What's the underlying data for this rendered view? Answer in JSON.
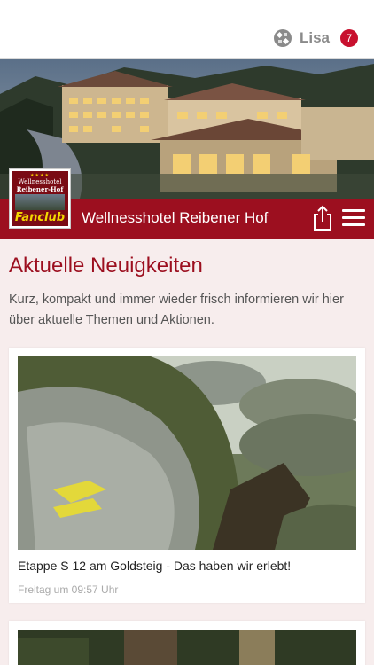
{
  "header": {
    "user_name": "Lisa",
    "notification_count": "7",
    "user_icon": "grid-logo-icon"
  },
  "titlebar": {
    "title": "Wellnesshotel Reibener Hof",
    "share_icon": "share-icon",
    "menu_icon": "hamburger-menu-icon"
  },
  "logo": {
    "stars": "★★★★",
    "line1": "Wellnesshotel",
    "line2": "Reibener-Hof",
    "fanclub": "Fanclub"
  },
  "main": {
    "heading": "Aktuelle Neuigkeiten",
    "intro": "Kurz, kompakt und immer wieder frisch informieren wir hier über aktuelle Themen und Aktionen.",
    "posts": [
      {
        "title": "Etappe S 12 am Goldsteig - Das haben wir erlebt!",
        "time": "Freitag um 09:57 Uhr"
      }
    ]
  },
  "colors": {
    "brand_red": "#9c0f1f",
    "badge_red": "#c8102e",
    "background": "#f7eded"
  }
}
